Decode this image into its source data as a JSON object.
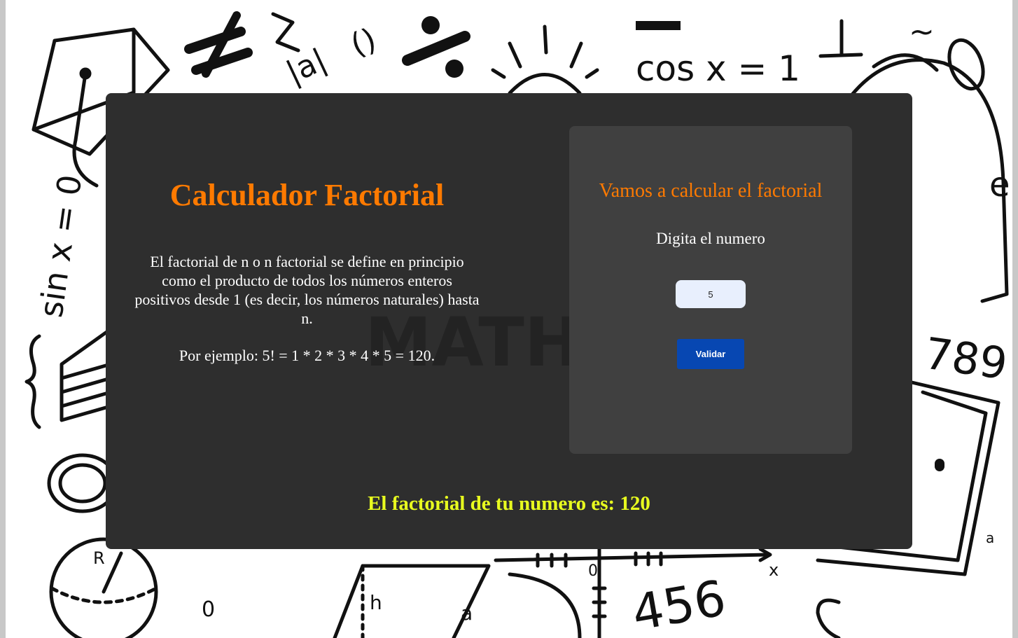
{
  "header": {
    "title": "Calculador Factorial"
  },
  "intro": {
    "description": "El factorial de n o n factorial se define en principio como el producto de todos los números enteros positivos desde 1 (es decir, los números naturales) hasta n.",
    "example": "Por ejemplo: 5! = 1 * 2 * 3 * 4 * 5 = 120."
  },
  "calculator": {
    "title": "Vamos a calcular el factorial",
    "input_label": "Digita el numero",
    "input_value": "5",
    "button_label": "Validar"
  },
  "result": {
    "text": "El factorial de tu numero es: 120"
  },
  "colors": {
    "accent_orange": "#ff7a00",
    "result_yellow": "#e9ff1f",
    "button_blue": "#0747b2",
    "card_bg": "#2e2e2e",
    "panel_bg": "#404040"
  }
}
